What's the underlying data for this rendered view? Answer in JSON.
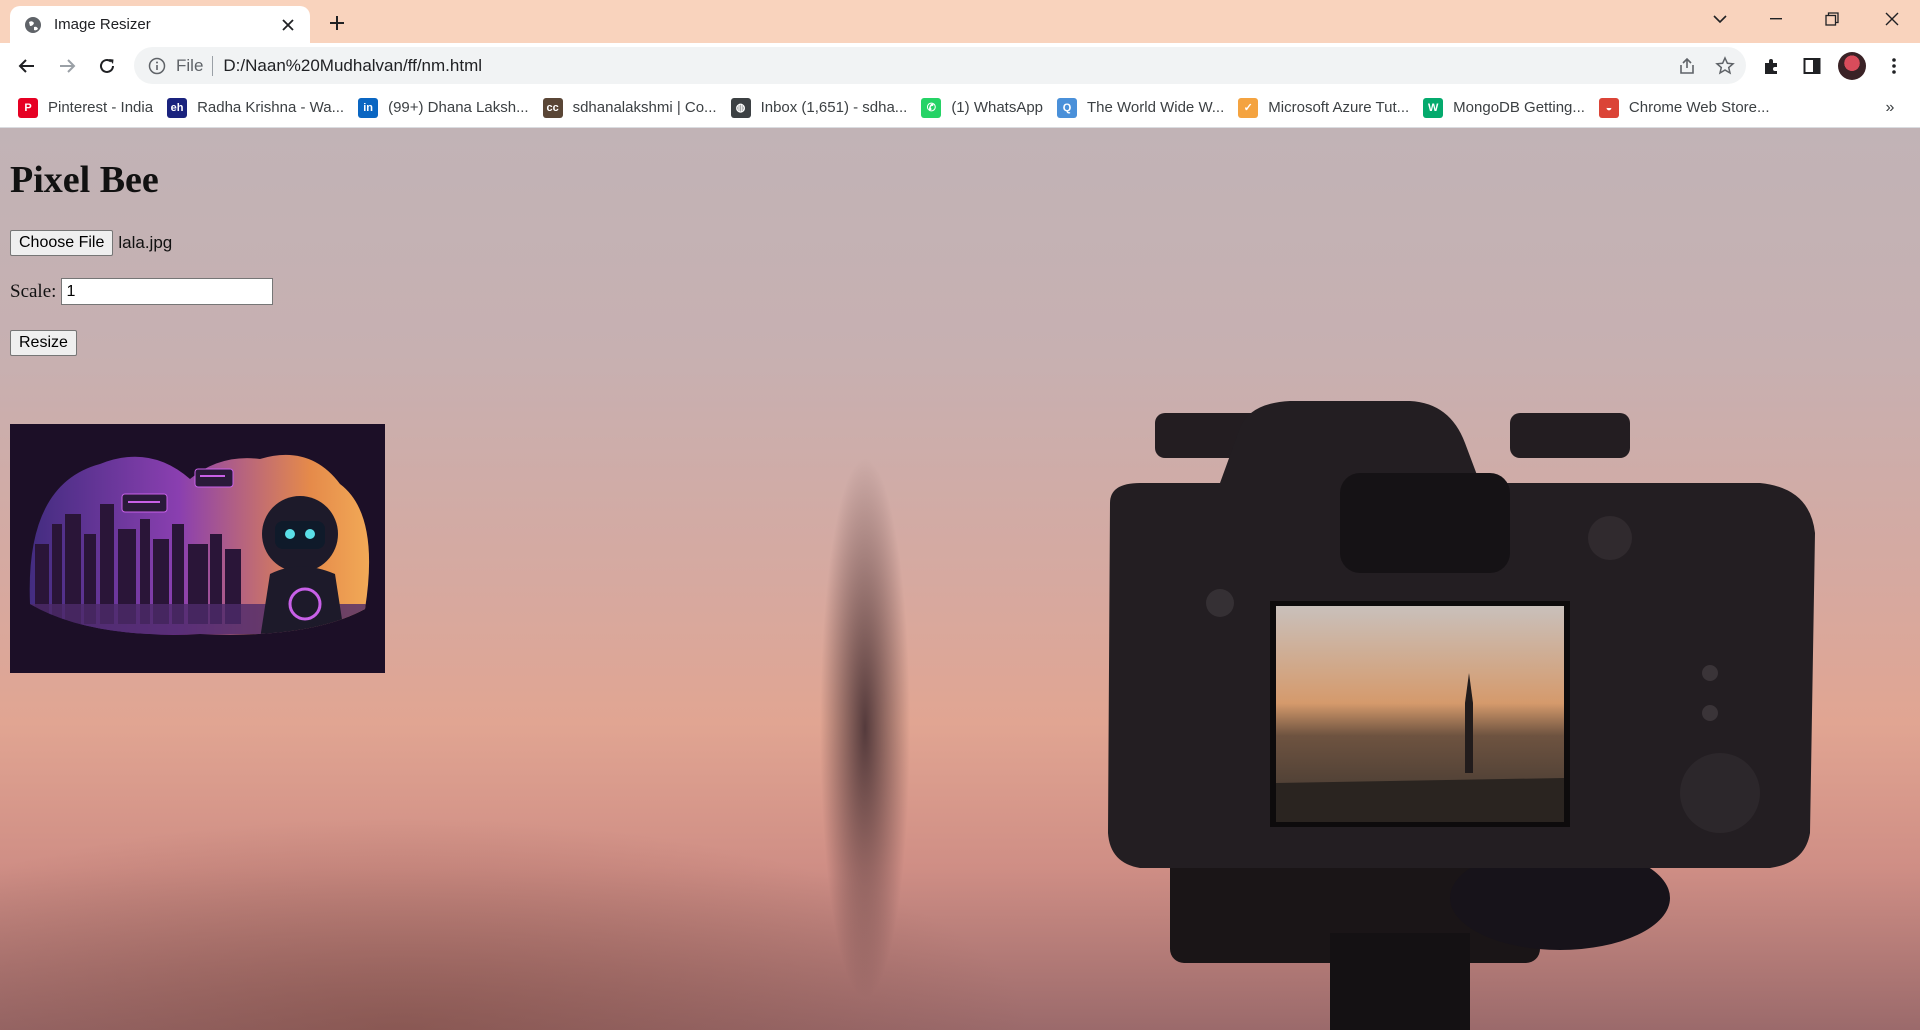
{
  "browser": {
    "tab_title": "Image Resizer",
    "url_scheme": "File",
    "url": "D:/Naan%20Mudhalvan/ff/nm.html"
  },
  "bookmarks": [
    {
      "label": "Pinterest - India",
      "icon": "pinterest-icon",
      "color": "#e60023",
      "glyph": "P"
    },
    {
      "label": "Radha Krishna - Wa...",
      "icon": "site-icon",
      "color": "#1a237e",
      "glyph": "eh"
    },
    {
      "label": "(99+) Dhana Laksh...",
      "icon": "linkedin-icon",
      "color": "#0a66c2",
      "glyph": "in"
    },
    {
      "label": "sdhanalakshmi | Co...",
      "icon": "cc-icon",
      "color": "#5a4636",
      "glyph": "cc"
    },
    {
      "label": "Inbox (1,651) - sdha...",
      "icon": "globe-icon",
      "color": "#3c4043",
      "glyph": "◍"
    },
    {
      "label": "(1) WhatsApp",
      "icon": "whatsapp-icon",
      "color": "#25d366",
      "glyph": "✆"
    },
    {
      "label": "The World Wide W...",
      "icon": "site-icon",
      "color": "#4a90d9",
      "glyph": "Q"
    },
    {
      "label": "Microsoft Azure Tut...",
      "icon": "azure-icon",
      "color": "#f4a340",
      "glyph": "✓"
    },
    {
      "label": "MongoDB Getting...",
      "icon": "w3-icon",
      "color": "#04aa6d",
      "glyph": "W"
    },
    {
      "label": "Chrome Web Store...",
      "icon": "chrome-icon",
      "color": "#db4437",
      "glyph": "◒"
    }
  ],
  "page": {
    "title": "Pixel Bee",
    "choose_file_label": "Choose File",
    "file_name": "lala.jpg",
    "scale_label": "Scale:",
    "scale_value": "1",
    "resize_label": "Resize"
  }
}
